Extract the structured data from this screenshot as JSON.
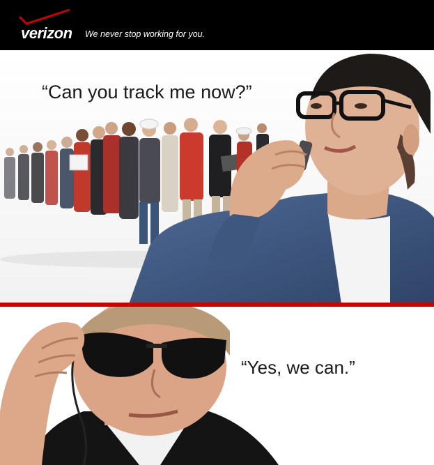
{
  "brand": {
    "name": "verizon",
    "tagline": "We never stop working for you.",
    "accent_color": "#cc0000"
  },
  "panels": {
    "top": {
      "quote": "“Can you track me now?”"
    },
    "bottom": {
      "quote": "“Yes, we can.”"
    }
  }
}
